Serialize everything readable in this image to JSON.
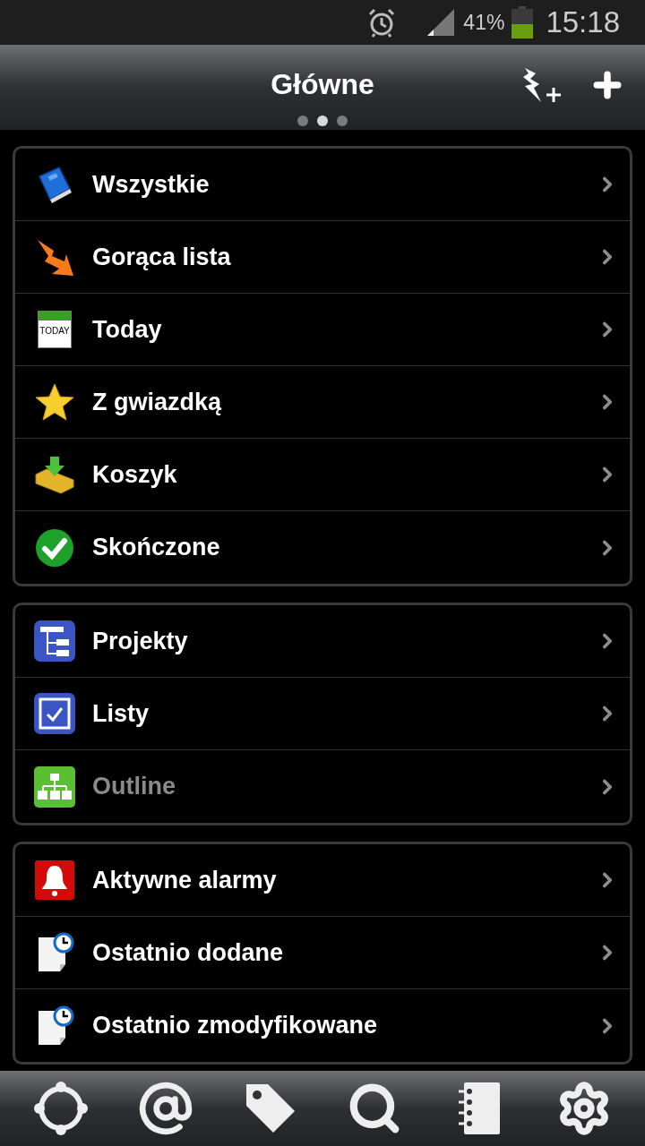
{
  "status_bar": {
    "battery_text": "41%",
    "time": "15:18"
  },
  "header": {
    "title": "Główne",
    "pages": [
      {
        "selected": false
      },
      {
        "selected": true
      },
      {
        "selected": false
      }
    ]
  },
  "groups": [
    {
      "items": [
        {
          "label": "Wszystkie",
          "disabled": false
        },
        {
          "label": "Gorąca lista",
          "disabled": false
        },
        {
          "label": "Today",
          "disabled": false,
          "icon_text": "TODAY"
        },
        {
          "label": "Z gwiazdką",
          "disabled": false
        },
        {
          "label": "Koszyk",
          "disabled": false
        },
        {
          "label": "Skończone",
          "disabled": false
        }
      ]
    },
    {
      "items": [
        {
          "label": "Projekty",
          "disabled": false
        },
        {
          "label": "Listy",
          "disabled": false
        },
        {
          "label": "Outline",
          "disabled": true
        }
      ]
    },
    {
      "items": [
        {
          "label": "Aktywne alarmy",
          "disabled": false
        },
        {
          "label": "Ostatnio dodane",
          "disabled": false
        },
        {
          "label": "Ostatnio zmodyfikowane",
          "disabled": false
        }
      ]
    }
  ]
}
